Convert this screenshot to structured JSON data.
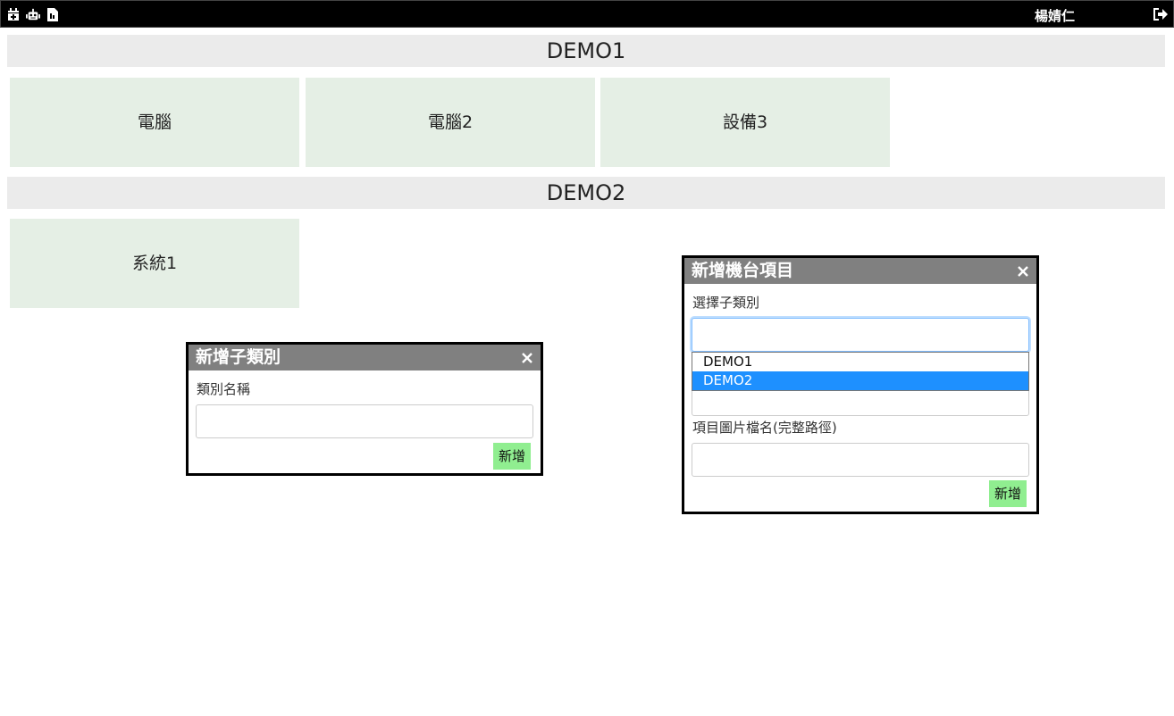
{
  "topbar": {
    "icons": [
      "calendar-plus-icon",
      "robot-icon",
      "file-icon"
    ],
    "user_name": "楊婧仁",
    "logout_icon": "sign-out-icon"
  },
  "categories": [
    {
      "title": "DEMO1",
      "items": [
        "電腦",
        "電腦2",
        "設備3"
      ]
    },
    {
      "title": "DEMO2",
      "items": [
        "系統1"
      ]
    }
  ],
  "dialog_subcategory": {
    "title": "新增子類別",
    "close_label": "×",
    "name_label": "類別名稱",
    "name_value": "",
    "submit_label": "新增"
  },
  "dialog_machine": {
    "title": "新增機台項目",
    "close_label": "×",
    "subcategory_label": "選擇子類別",
    "subcategory_value": "",
    "image_label": "項目圖片檔名(完整路徑)",
    "image_value": "",
    "submit_label": "新增",
    "dropdown_options": [
      "DEMO1",
      "DEMO2"
    ],
    "dropdown_highlighted": "DEMO2"
  },
  "colors": {
    "tile_bg": "#e5efe5",
    "header_bg": "#ebebeb",
    "dialog_title_bg": "#808080",
    "button_bg": "#90ee90",
    "highlight": "#1e90ff"
  }
}
